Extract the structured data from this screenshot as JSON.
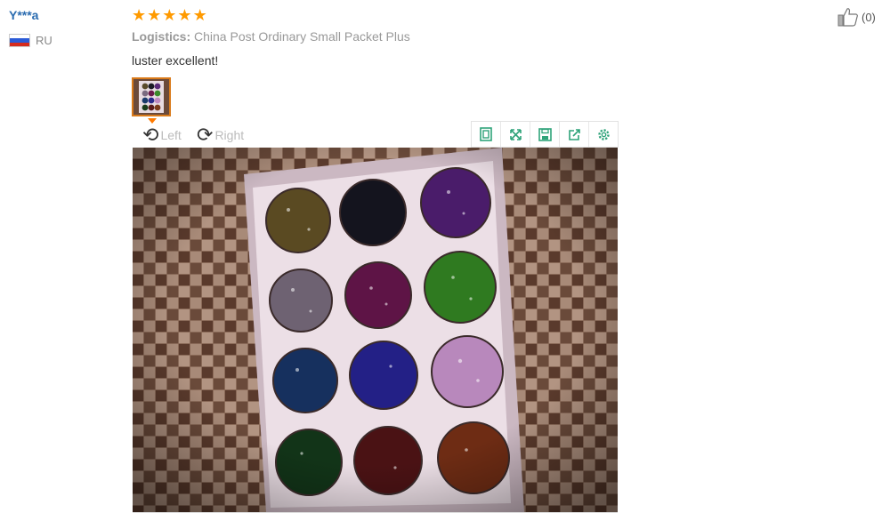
{
  "review": {
    "user_name": "Y***a",
    "country_code": "RU",
    "rating": 5,
    "logistics_label": "Logistics:",
    "logistics_value": "China Post Ordinary Small Packet Plus",
    "text": "luster excellent!",
    "like_count": "(0)"
  },
  "viewer": {
    "rotate_left_label": "Left",
    "rotate_right_label": "Right",
    "tools": [
      "fit-icon",
      "fullscreen-icon",
      "save-icon",
      "share-icon",
      "settings-icon"
    ]
  },
  "colors": {
    "star": "#ff9a00",
    "user_link": "#2b6cb0",
    "tool_icon": "#2fa37a",
    "thumb_border": "#d97a1a"
  }
}
